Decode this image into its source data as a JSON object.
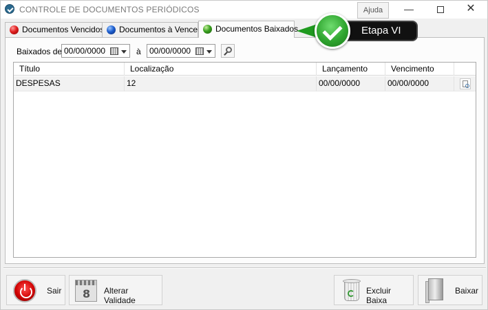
{
  "window": {
    "title": "CONTROLE DE DOCUMENTOS PERIÓDICOS",
    "help_label": "Ajuda",
    "minimize_glyph": "—",
    "close_glyph": "✕"
  },
  "tabs": [
    {
      "label": "Documentos Vencidos",
      "icon": "red-dot-icon"
    },
    {
      "label": "Documentos à Vencer",
      "icon": "blue-dot-icon"
    },
    {
      "label": "Documentos Baixados",
      "icon": "green-dot-icon",
      "active": true
    }
  ],
  "filter": {
    "label": "Baixados de",
    "from_value": "00/00/0000",
    "to_label": "à",
    "to_value": "00/00/0000"
  },
  "grid": {
    "columns": [
      "Título",
      "Localização",
      "Lançamento",
      "Vencimento"
    ],
    "rows": [
      {
        "titulo": "DESPESAS",
        "localizacao": "12",
        "lancamento": "00/00/0000",
        "vencimento": "00/00/0000"
      }
    ]
  },
  "buttons": {
    "sair": "Sair",
    "alterar_validade": "Alterar Validade",
    "calendar_number": "8",
    "excluir_baixa": "Excluir Baixa",
    "baixar": "Baixar"
  },
  "callout": {
    "label": "Etapa VI"
  },
  "colors": {
    "callout_green": "#2fa52f",
    "callout_bg": "#111111"
  }
}
